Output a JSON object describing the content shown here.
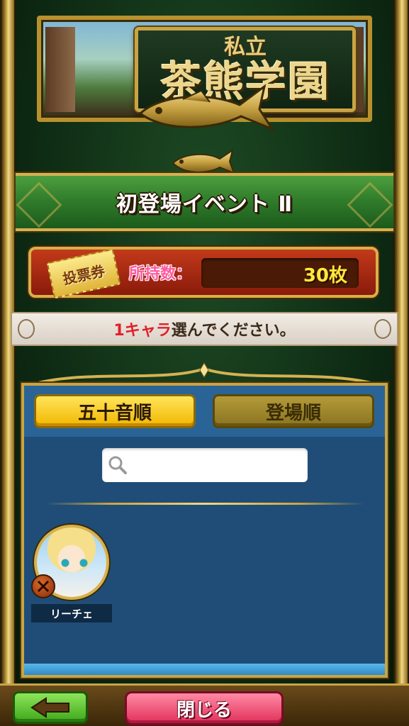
{
  "logo": {
    "subtitle": "私立",
    "title": "茶熊学園"
  },
  "event": {
    "title": "初登場イベント Ⅱ"
  },
  "tickets": {
    "icon_label": "投票券",
    "label": "所持数：",
    "count": "30枚"
  },
  "instruction": {
    "accent": "1キャラ",
    "rest": "選んでください。"
  },
  "tabs": [
    {
      "label": "五十音順",
      "active": true
    },
    {
      "label": "登場順",
      "active": false
    }
  ],
  "search": {
    "value": "",
    "placeholder": ""
  },
  "characters": [
    {
      "name": "リーチェ"
    }
  ],
  "footer": {
    "close_label": "閉じる"
  },
  "colors": {
    "accent_gold": "#c9a445",
    "panel_blue": "#1f4d78",
    "ticket_count": "#ffe93a",
    "instruction_accent": "#e0202a",
    "close_button": "#e0305a",
    "back_button": "#3ea81a"
  },
  "icons": [
    "search-icon",
    "back-arrow-icon",
    "fish-emblem-icon",
    "class-badge-icon"
  ]
}
